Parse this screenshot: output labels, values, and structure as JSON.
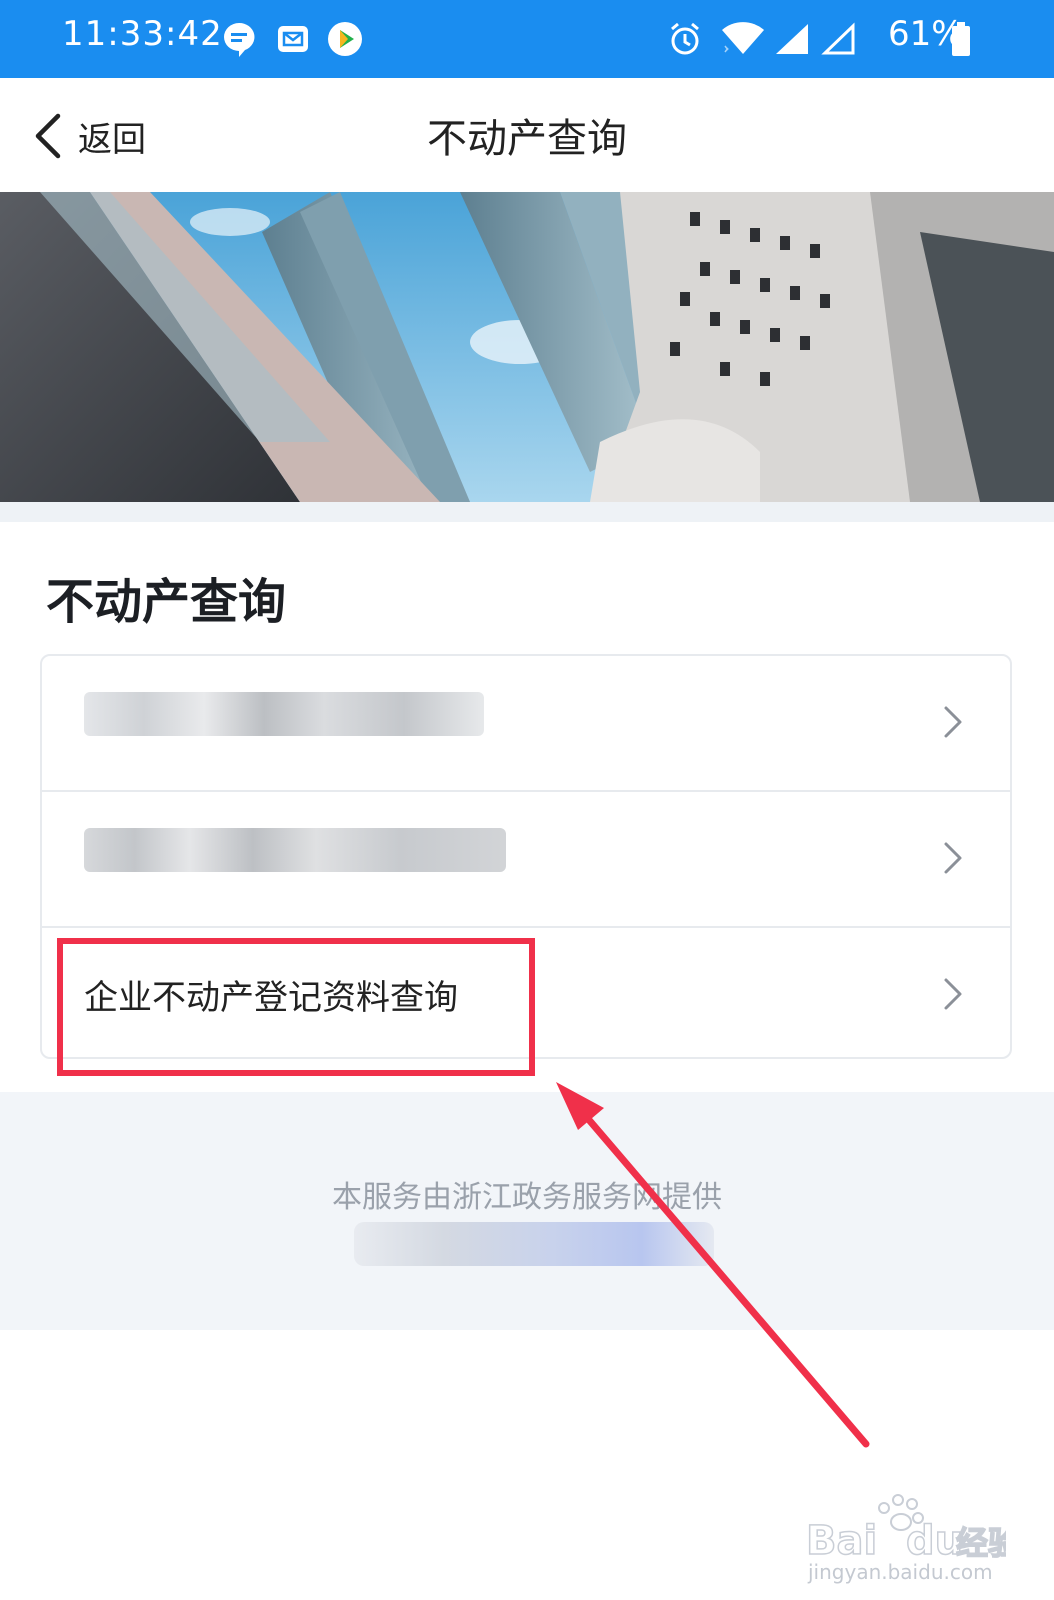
{
  "status_bar": {
    "time": "11:33:42",
    "battery_percent": "61%",
    "icons": [
      "chat-icon",
      "mail-icon",
      "play-icon",
      "alarm-icon",
      "wifi-icon",
      "signal-icon",
      "signal-empty-icon",
      "battery-icon"
    ]
  },
  "nav": {
    "back_label": "返回",
    "title": "不动产查询"
  },
  "section": {
    "title": "不动产查询",
    "items": [
      {
        "label": "",
        "blurred": true
      },
      {
        "label": "",
        "blurred": true
      },
      {
        "label": "企业不动产登记资料查询",
        "blurred": false
      }
    ]
  },
  "footer": {
    "provider_text": "本服务由浙江政务服务网提供"
  },
  "watermark": {
    "brand": "Bai du 经验",
    "url": "jingyan.baidu.com"
  },
  "colors": {
    "status_bar": "#1a8df0",
    "highlight": "#f0304a",
    "footer_bg": "#f2f5f9"
  }
}
